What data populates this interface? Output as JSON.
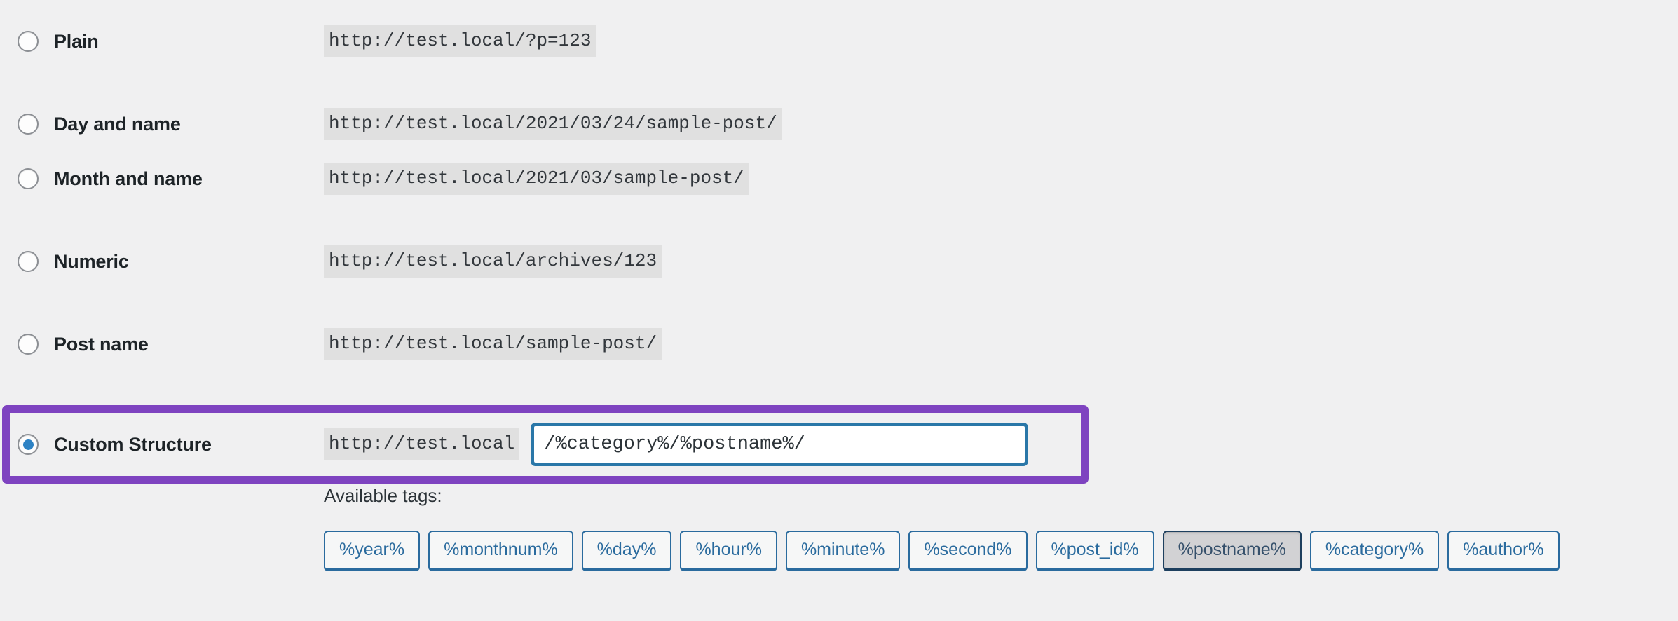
{
  "colors": {
    "page_background": "#f0f0f1",
    "highlight_border": "#7e43c0",
    "input_focus_border": "#2a77a8",
    "radio_checked_dot": "#2d82c4",
    "tag_border": "#2a6b9e",
    "tag_active_background": "#d2d2d4"
  },
  "permalink_options": [
    {
      "id": "plain",
      "label": "Plain",
      "url": "http://test.local/?p=123",
      "selected": false
    },
    {
      "id": "day",
      "label": "Day and name",
      "url": "http://test.local/2021/03/24/sample-post/",
      "selected": false
    },
    {
      "id": "month",
      "label": "Month and name",
      "url": "http://test.local/2021/03/sample-post/",
      "selected": false
    },
    {
      "id": "numeric",
      "label": "Numeric",
      "url": "http://test.local/archives/123",
      "selected": false
    },
    {
      "id": "postname",
      "label": "Post name",
      "url": "http://test.local/sample-post/",
      "selected": false
    }
  ],
  "custom_structure": {
    "label": "Custom Structure",
    "base_url": "http://test.local",
    "value": "/%category%/%postname%/",
    "selected": true
  },
  "available_tags": {
    "label": "Available tags:",
    "tags": [
      {
        "label": "%year%",
        "active": false
      },
      {
        "label": "%monthnum%",
        "active": false
      },
      {
        "label": "%day%",
        "active": false
      },
      {
        "label": "%hour%",
        "active": false
      },
      {
        "label": "%minute%",
        "active": false
      },
      {
        "label": "%second%",
        "active": false
      },
      {
        "label": "%post_id%",
        "active": false
      },
      {
        "label": "%postname%",
        "active": true
      },
      {
        "label": "%category%",
        "active": false
      },
      {
        "label": "%author%",
        "active": false
      }
    ]
  }
}
